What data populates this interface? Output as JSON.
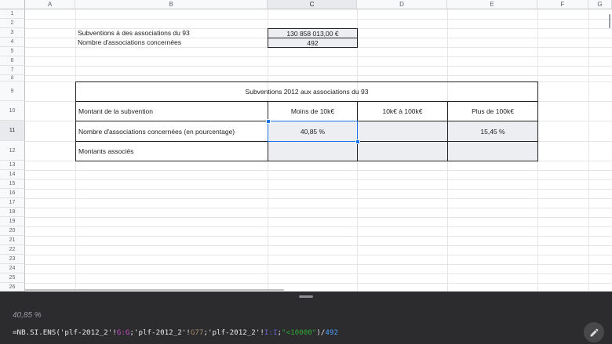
{
  "columns": [
    "A",
    "B",
    "C",
    "D",
    "E",
    "F",
    "G"
  ],
  "rows": [
    "1",
    "2",
    "3",
    "4",
    "5",
    "6",
    "7",
    "8",
    "9",
    "10",
    "11",
    "12",
    "13",
    "14",
    "15",
    "16",
    "17",
    "18",
    "19",
    "20",
    "21",
    "22",
    "23",
    "24",
    "25",
    "26"
  ],
  "cells": {
    "B3": "Subventions à des associations du 93",
    "C3": "130 858 013,00 €",
    "B4": "Nombre d'associations concernées",
    "C4": "492",
    "B9": "Subventions 2012 aux associations du 93",
    "B10": "Montant de la subvention",
    "C10": "Moins de 10k€",
    "D10": "10k€ à 100k€",
    "E10": "Plus de 100k€",
    "B11": "Nombre d'associations concernées (en pourcentage)",
    "C11": "40,85 %",
    "D11": "",
    "E11": "15,45 %",
    "B12": "Montants associés",
    "C12": "",
    "D12": "",
    "E12": ""
  },
  "selected_cell": "C11",
  "formula_panel": {
    "value": "40,85 %",
    "formula_parts": [
      {
        "text": "=NB.SI.ENS('plf-2012_2'!",
        "color": "default"
      },
      {
        "text": "G:G",
        "color": "magenta"
      },
      {
        "text": ";'plf-2012_2'!",
        "color": "default"
      },
      {
        "text": "G77",
        "color": "brown"
      },
      {
        "text": ";'plf-2012_2'!",
        "color": "default"
      },
      {
        "text": "I:I",
        "color": "purple"
      },
      {
        "text": ";",
        "color": "default"
      },
      {
        "text": "\"<10000\"",
        "color": "green"
      },
      {
        "text": ")/",
        "color": "default"
      },
      {
        "text": "492",
        "color": "blue"
      }
    ],
    "edit_icon": "pencil-icon"
  },
  "colors": {
    "selection": "#1a73e8",
    "panel_bg": "#2c2c2e",
    "shade": "#eceef1"
  }
}
